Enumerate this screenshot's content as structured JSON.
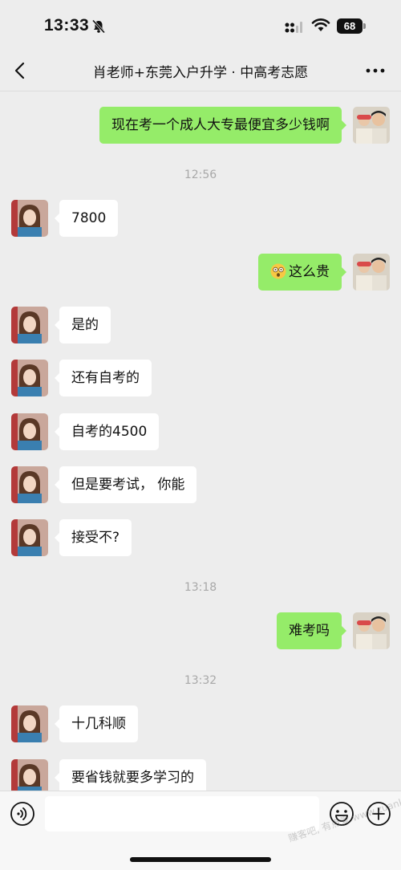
{
  "status_bar": {
    "time": "13:33",
    "battery": "68"
  },
  "nav": {
    "title": "肖老师+东莞入户升学 · 中高考志愿"
  },
  "colors": {
    "outgoing_bubble": "#95ec69",
    "incoming_bubble": "#ffffff",
    "background": "#ededed"
  },
  "messages": [
    {
      "side": "right",
      "text": "现在考一个成人大专最便宜多少钱啊"
    },
    {
      "timestamp": "12:56"
    },
    {
      "side": "left",
      "text": "7800"
    },
    {
      "side": "right",
      "text": "这么贵",
      "emoji": "dizzy-face-emoji"
    },
    {
      "side": "left",
      "text": "是的"
    },
    {
      "side": "left",
      "text": "还有自考的"
    },
    {
      "side": "left",
      "text": "自考的4500"
    },
    {
      "side": "left",
      "text": "但是要考试， 你能"
    },
    {
      "side": "left",
      "text": "接受不?"
    },
    {
      "timestamp": "13:18"
    },
    {
      "side": "right",
      "text": "难考吗"
    },
    {
      "timestamp": "13:32"
    },
    {
      "side": "left",
      "text": "十几科顺"
    },
    {
      "side": "left",
      "text": "要省钱就要多学习的"
    }
  ],
  "input": {
    "placeholder": ""
  },
  "watermark": "赚客吧, 有点爱 www.zuanke8.com",
  "icons": [
    "bell-muted-icon",
    "signal-icon",
    "wifi-icon",
    "battery-icon",
    "back-chevron-icon",
    "more-dots-icon",
    "voice-icon",
    "emoji-icon",
    "plus-icon"
  ]
}
